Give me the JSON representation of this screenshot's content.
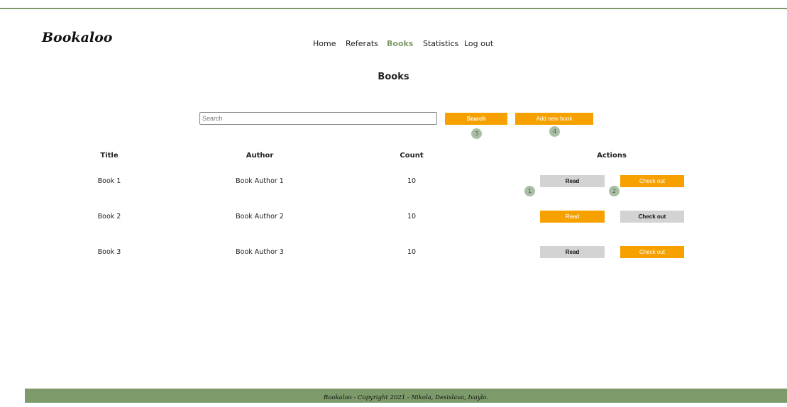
{
  "brand": {
    "logo": "Bookaloo"
  },
  "nav": {
    "items": [
      {
        "label": "Home",
        "active": false
      },
      {
        "label": "Referats",
        "active": false
      },
      {
        "label": "Books",
        "active": true
      },
      {
        "label": "Statistics",
        "active": false
      },
      {
        "label": "Log out",
        "active": false
      }
    ]
  },
  "page": {
    "title": "Books"
  },
  "search": {
    "placeholder": "Search",
    "button_label": "Search",
    "add_button_label": "Add new book",
    "search_badge": "3",
    "add_badge": "4"
  },
  "table": {
    "headers": [
      "Title",
      "Author",
      "Count",
      "Actions"
    ],
    "rows": [
      {
        "title": "Book 1",
        "author": "Book Author 1",
        "count": "10",
        "read_label": "Read",
        "checkout_label": "Check out",
        "read_badge": "1",
        "checkout_badge": "2"
      },
      {
        "title": "Book 2",
        "author": "Book Author 2",
        "count": "10",
        "read_label": "Read",
        "checkout_label": "Check out"
      },
      {
        "title": "Book 3",
        "author": "Book Author 3",
        "count": "10",
        "read_label": "Read",
        "checkout_label": "Check out"
      }
    ]
  },
  "colors": {
    "accent": "#f7a100",
    "brand_green": "#7d9a6a",
    "neutral_button": "#d3d3d3"
  },
  "footer": {
    "text": "Bookaloo - Copyright 2021 - Nikola, Desislava, Ivaylo."
  }
}
